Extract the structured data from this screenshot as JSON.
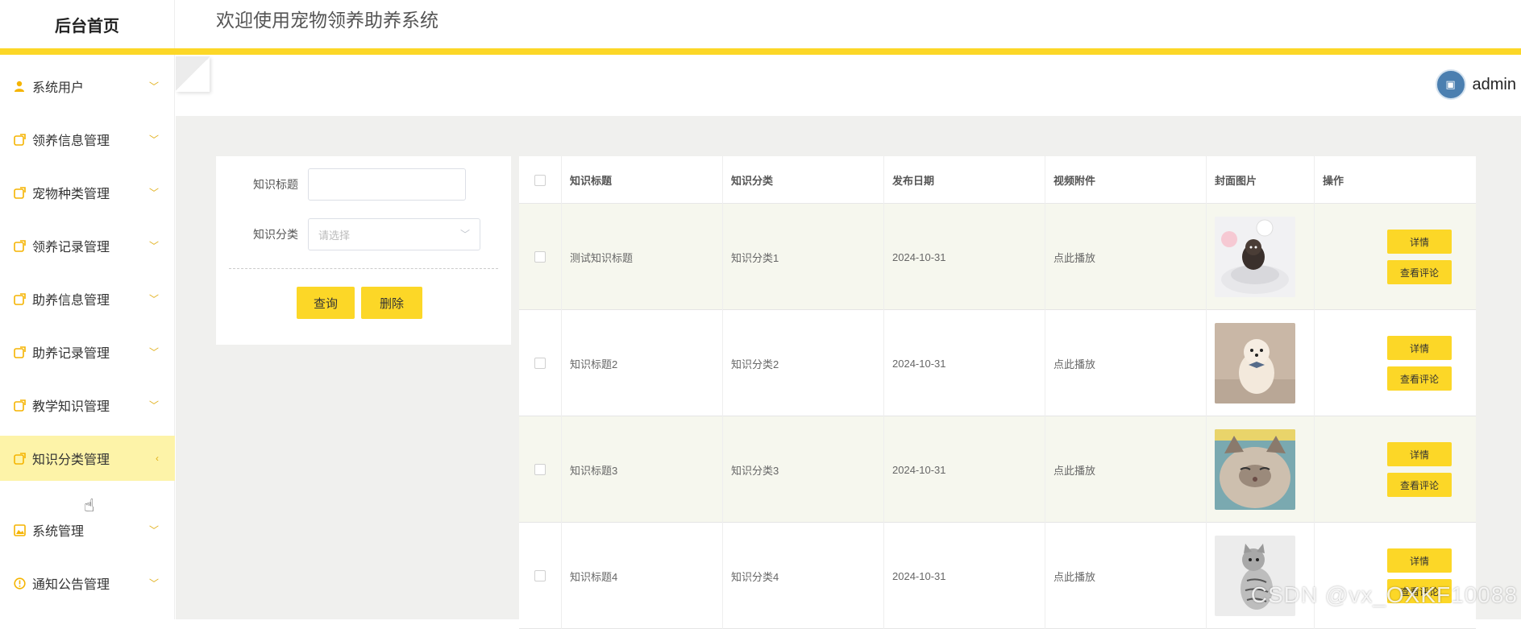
{
  "header": {
    "brand": "后台首页",
    "welcome": "欢迎使用宠物领养助养系统"
  },
  "user": {
    "name": "admin"
  },
  "sidebar": {
    "items": [
      {
        "label": "系统用户",
        "icon": "user-icon"
      },
      {
        "label": "领养信息管理",
        "icon": "share-icon"
      },
      {
        "label": "宠物种类管理",
        "icon": "share-icon"
      },
      {
        "label": "领养记录管理",
        "icon": "share-icon"
      },
      {
        "label": "助养信息管理",
        "icon": "share-icon"
      },
      {
        "label": "助养记录管理",
        "icon": "share-icon"
      },
      {
        "label": "教学知识管理",
        "icon": "share-icon"
      },
      {
        "label": "知识分类管理",
        "icon": "share-icon",
        "active": true
      },
      {
        "label": "系统管理",
        "icon": "image-icon"
      },
      {
        "label": "通知公告管理",
        "icon": "info-circle-icon"
      }
    ]
  },
  "search": {
    "title_label": "知识标题",
    "title_value": "",
    "category_label": "知识分类",
    "category_placeholder": "请选择",
    "query_button": "查询",
    "delete_button": "删除"
  },
  "table": {
    "columns": [
      "知识标题",
      "知识分类",
      "发布日期",
      "视频附件",
      "封面图片",
      "操作"
    ],
    "rows": [
      {
        "title": "测试知识标题",
        "category": "知识分类1",
        "date": "2024-10-31",
        "video": "点此播放",
        "image": "dog-on-bed-photo"
      },
      {
        "title": "知识标题2",
        "category": "知识分类2",
        "date": "2024-10-31",
        "video": "点此播放",
        "image": "pomeranian-photo"
      },
      {
        "title": "知识标题3",
        "category": "知识分类3",
        "date": "2024-10-31",
        "video": "点此播放",
        "image": "cat-face-photo"
      },
      {
        "title": "知识标题4",
        "category": "知识分类4",
        "date": "2024-10-31",
        "video": "点此播放",
        "image": "tabby-cat-photo"
      }
    ],
    "detail_button": "详情",
    "comments_button": "查看评论"
  },
  "watermark": "CSDN @vx_OXKF10088",
  "colors": {
    "accent": "#fcd727",
    "active_menu_bg": "#fdf3a8",
    "icon": "#f5b400"
  }
}
